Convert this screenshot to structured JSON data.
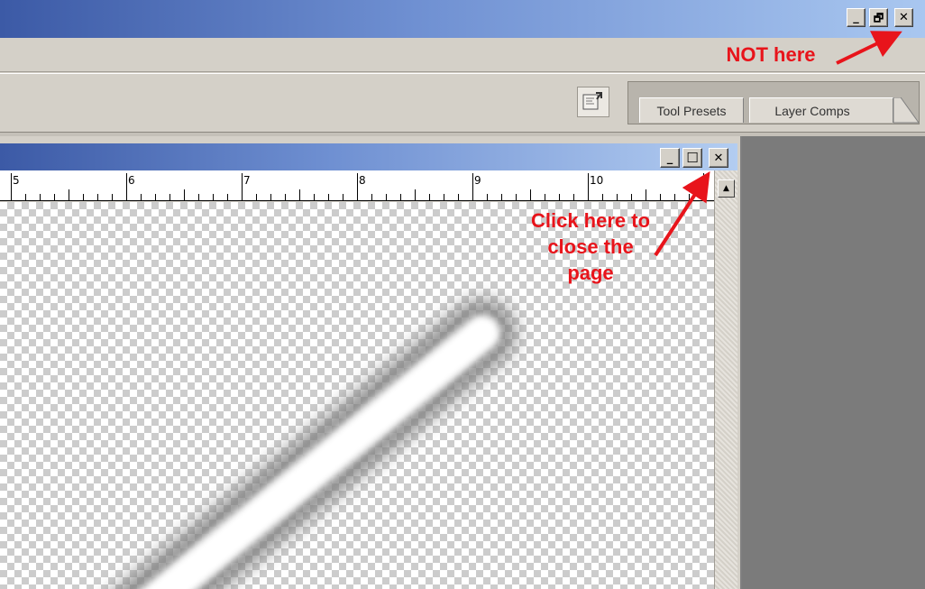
{
  "app_window": {
    "minimize_glyph": "_",
    "restore_glyph": "🗗",
    "close_glyph": "✕"
  },
  "options_bar": {
    "palette_icon": "palette-well-icon",
    "tabs": [
      {
        "label": "Tool Presets"
      },
      {
        "label": "Layer Comps"
      }
    ]
  },
  "document_window": {
    "minimize_glyph": "_",
    "maximize_glyph": "☐",
    "close_glyph": "✕",
    "ruler_numbers": [
      "5",
      "6",
      "7",
      "8",
      "9",
      "10"
    ],
    "scroll_up_glyph": "▲"
  },
  "annotations": {
    "not_here": "NOT here",
    "click_here": [
      "Click here to",
      "close the",
      "page"
    ],
    "color": "#e8141b"
  },
  "colors": {
    "titlebar_start": "#3c5aa6",
    "titlebar_end": "#a9c7f0",
    "chrome": "#d4d0c8",
    "workspace": "#7b7b7b"
  }
}
